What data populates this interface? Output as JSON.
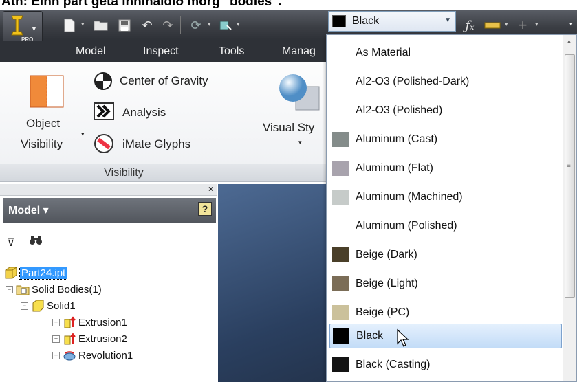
{
  "caption": "Ath: Einn part geta innihaldið mörg \"bodies\".",
  "app": {
    "edition_badge": "PRO"
  },
  "appearance_combo": {
    "selected": "Black",
    "selected_color": "#000000"
  },
  "ribbon_tabs": [
    "Model",
    "Inspect",
    "Tools",
    "Manag"
  ],
  "visibility_panel": {
    "object_visibility": [
      "Object",
      "Visibility"
    ],
    "items": [
      "Center of Gravity",
      "Analysis",
      "iMate Glyphs"
    ],
    "title": "Visibility"
  },
  "visual_style": {
    "label": "Visual Sty"
  },
  "browser": {
    "header": "Model",
    "tree": [
      {
        "label": "Part24.ipt",
        "level": 0,
        "selected": true
      },
      {
        "label": "Solid Bodies(1)",
        "level": 1
      },
      {
        "label": "Solid1",
        "level": 2
      },
      {
        "label": "Extrusion1",
        "level": 3
      },
      {
        "label": "Extrusion2",
        "level": 3
      },
      {
        "label": "Revolution1",
        "level": 3
      }
    ]
  },
  "materials": [
    {
      "label": "As Material",
      "color": null
    },
    {
      "label": "Al2-O3 (Polished-Dark)",
      "color": null
    },
    {
      "label": "Al2-O3 (Polished)",
      "color": null
    },
    {
      "label": "Aluminum (Cast)",
      "color": "#848c8a"
    },
    {
      "label": "Aluminum (Flat)",
      "color": "#a8a3ad"
    },
    {
      "label": "Aluminum (Machined)",
      "color": "#c6cbc9"
    },
    {
      "label": "Aluminum (Polished)",
      "color": null
    },
    {
      "label": "Beige (Dark)",
      "color": "#4a3f29"
    },
    {
      "label": "Beige (Light)",
      "color": "#7b6d57"
    },
    {
      "label": "Beige (PC)",
      "color": "#cbc19b"
    },
    {
      "label": "Black",
      "color": "#000000",
      "highlighted": true
    },
    {
      "label": "Black (Casting)",
      "color": "#141414"
    }
  ],
  "icons": {
    "new": "new-file-icon",
    "open": "open-folder-icon",
    "save": "save-icon",
    "undo": "undo-icon",
    "redo": "redo-icon",
    "fx": "function-icon",
    "filter": "filter-icon",
    "find": "binoculars-icon",
    "help": "help-icon"
  }
}
